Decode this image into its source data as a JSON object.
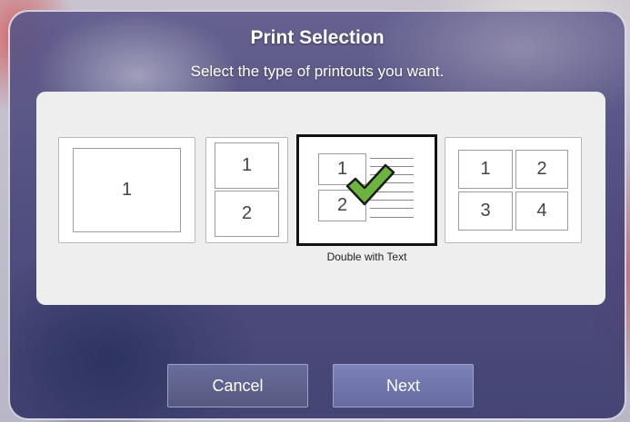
{
  "dialog": {
    "title": "Print Selection",
    "subtitle": "Select the type of printouts you want."
  },
  "options": [
    {
      "id": "single",
      "cells": [
        "1"
      ],
      "selected": false
    },
    {
      "id": "double",
      "cells": [
        "1",
        "2"
      ],
      "selected": false
    },
    {
      "id": "double-with-text",
      "cells": [
        "1",
        "2"
      ],
      "caption": "Double with Text",
      "selected": true
    },
    {
      "id": "quad",
      "cells": [
        "1",
        "2",
        "3",
        "4"
      ],
      "selected": false
    }
  ],
  "buttons": {
    "cancel": "Cancel",
    "next": "Next"
  },
  "colors": {
    "dialog_background": "#4f4d86",
    "panel_background": "#eeeeee",
    "checkmark_fill": "#6db33f",
    "selected_border": "#111111"
  }
}
